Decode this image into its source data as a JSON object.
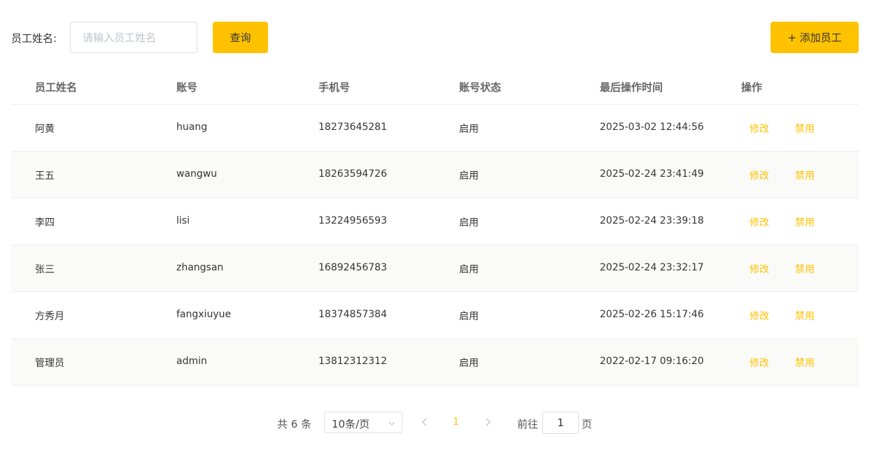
{
  "search": {
    "label": "员工姓名:",
    "placeholder": "请输入员工姓名",
    "query_button": "查询",
    "add_button": "+ 添加员工"
  },
  "table": {
    "headers": [
      "员工姓名",
      "账号",
      "手机号",
      "账号状态",
      "最后操作时间",
      "操作"
    ],
    "rows": [
      {
        "name": "阿黄",
        "account": "huang",
        "phone": "18273645281",
        "status": "启用",
        "last_time": "2025-03-02 12:44:56",
        "edit": "修改",
        "disable": "禁用"
      },
      {
        "name": "王五",
        "account": "wangwu",
        "phone": "18263594726",
        "status": "启用",
        "last_time": "2025-02-24 23:41:49",
        "edit": "修改",
        "disable": "禁用"
      },
      {
        "name": "李四",
        "account": "lisi",
        "phone": "13224956593",
        "status": "启用",
        "last_time": "2025-02-24 23:39:18",
        "edit": "修改",
        "disable": "禁用"
      },
      {
        "name": "张三",
        "account": "zhangsan",
        "phone": "16892456783",
        "status": "启用",
        "last_time": "2025-02-24 23:32:17",
        "edit": "修改",
        "disable": "禁用"
      },
      {
        "name": "方秀月",
        "account": "fangxiuyue",
        "phone": "18374857384",
        "status": "启用",
        "last_time": "2025-02-26 15:17:46",
        "edit": "修改",
        "disable": "禁用"
      },
      {
        "name": "管理员",
        "account": "admin",
        "phone": "13812312312",
        "status": "启用",
        "last_time": "2022-02-17 09:16:20",
        "edit": "修改",
        "disable": "禁用"
      }
    ]
  },
  "pagination": {
    "total": "共 6 条",
    "page_size": "10条/页",
    "current_page": "1",
    "goto_label": "前往",
    "goto_value": "1",
    "goto_suffix": "页"
  },
  "colors": {
    "accent": "#ffc200",
    "border": "#dcdfe6",
    "row_alt": "#fafaf8"
  },
  "icons": {
    "select": "chevron-down-icon",
    "prev": "chevron-left-icon",
    "next": "chevron-right-icon"
  }
}
